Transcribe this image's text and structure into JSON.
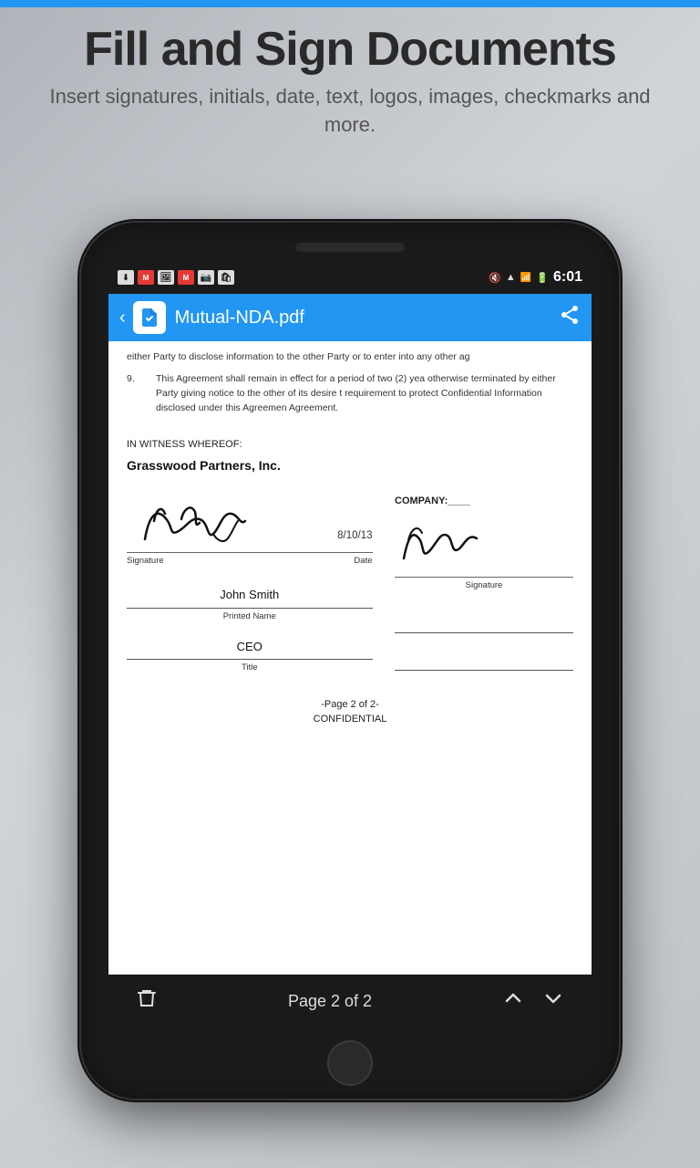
{
  "top_stripe": {},
  "promo": {
    "title": "Fill and Sign Documents",
    "subtitle": "Insert signatures, initials, date, text, logos,\nimages, checkmarks and more."
  },
  "status_bar": {
    "time": "6:01",
    "icons_left": [
      "download",
      "gmail",
      "image",
      "gmail2",
      "camera",
      "bag"
    ]
  },
  "toolbar": {
    "title": "Mutual-NDA.pdf",
    "back_label": "‹",
    "share_label": "share"
  },
  "document": {
    "text_top": "either Party to disclose information to the other Party or to enter into any other ag",
    "section_9": "This Agreement shall remain in effect for a period of two (2) yea otherwise terminated by either Party giving notice to the other of its desire t requirement to protect Confidential Information disclosed under this Agreemen Agreement.",
    "witness_label": "IN WITNESS WHEREOF:",
    "company_name": "Grasswood Partners, Inc.",
    "company_right_label": "COMPANY:____",
    "sig_left_label": "Signature",
    "sig_right_label": "Signature",
    "date_label": "Date",
    "date_value": "8/10/13",
    "printed_name_val": "John Smith",
    "printed_name_label": "Printed Name",
    "title_val": "CEO",
    "title_label": "Title",
    "page_footer_line1": "-Page 2 of 2-",
    "page_footer_line2": "CONFIDENTIAL"
  },
  "bottom_bar": {
    "page_info": "Page 2 of 2",
    "trash_label": "🗑",
    "up_label": "∧",
    "down_label": "∨"
  }
}
